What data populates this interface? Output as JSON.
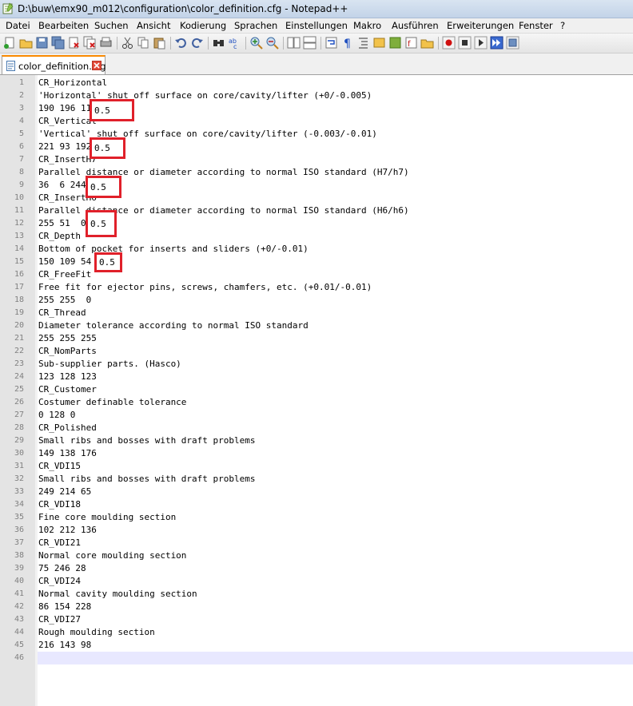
{
  "window": {
    "title": "D:\\buw\\emx90_m012\\configuration\\color_definition.cfg - Notepad++"
  },
  "menu": [
    "Datei",
    "Bearbeiten",
    "Suchen",
    "Ansicht",
    "Kodierung",
    "Sprachen",
    "Einstellungen",
    "Makro",
    "Ausführen",
    "Erweiterungen",
    "Fenster",
    "?"
  ],
  "toolbar": {
    "buttons": [
      "new-file",
      "open-file",
      "save",
      "save-all",
      "close",
      "close-all",
      "print",
      "cut",
      "copy",
      "paste",
      "undo",
      "redo",
      "find",
      "replace",
      "zoom-in",
      "zoom-out",
      "sync-vertical",
      "sync-horizontal",
      "word-wrap",
      "show-all-chars",
      "indent-guide",
      "user-defined-language",
      "document-map",
      "function-list",
      "folder-as-workspace",
      "record-macro",
      "stop-record",
      "play-macro",
      "run-macro-multiple",
      "save-macro"
    ]
  },
  "tab": {
    "label": "color_definition.cfg"
  },
  "editor": {
    "current_line": 46,
    "lines": [
      "CR_Horizontal",
      "'Horizontal' shut off surface on core/cavity/lifter (+0/-0.005)",
      "190 196 118",
      "CR_Vertical",
      "'Vertical' shut off surface on core/cavity/lifter (-0.003/-0.01)",
      "221 93 192",
      "CR_InsertH7",
      "Parallel distance or diameter according to normal ISO standard (H7/h7)",
      "36  6 244",
      "CR_InsertH6",
      "Parallel distance or diameter according to normal ISO standard (H6/h6)",
      "255 51  0",
      "CR_Depth",
      "Bottom of pocket for inserts and sliders (+0/-0.01)",
      "150 109 54",
      "CR_FreeFit",
      "Free fit for ejector pins, screws, chamfers, etc. (+0.01/-0.01)",
      "255 255  0",
      "CR_Thread",
      "Diameter tolerance according to normal ISO standard",
      "255 255 255",
      "CR_NomParts",
      "Sub-supplier parts. (Hasco)",
      "123 128 123",
      "CR_Customer",
      "Costumer definable tolerance",
      "0 128 0",
      "CR_Polished",
      "Small ribs and bosses with draft problems",
      "149 138 176",
      "CR_VDI15",
      "Small ribs and bosses with draft problems",
      "249 214 65",
      "CR_VDI18",
      "Fine core moulding section",
      "102 212 136",
      "CR_VDI21",
      "Normal core moulding section",
      "75 246 28",
      "CR_VDI24",
      "Normal cavity moulding section",
      "86 154 228",
      "CR_VDI27",
      "Rough moulding section",
      "216 143 98",
      ""
    ],
    "highlights": [
      {
        "text": "0.5"
      },
      {
        "text": "0.5"
      },
      {
        "text": "0.5"
      },
      {
        "text": "0.5"
      },
      {
        "text": "0.5"
      }
    ]
  },
  "colors": {
    "highlight_border": "#e0202a",
    "current_line": "#e8e8ff",
    "tab_accent": "#fa8a00"
  }
}
